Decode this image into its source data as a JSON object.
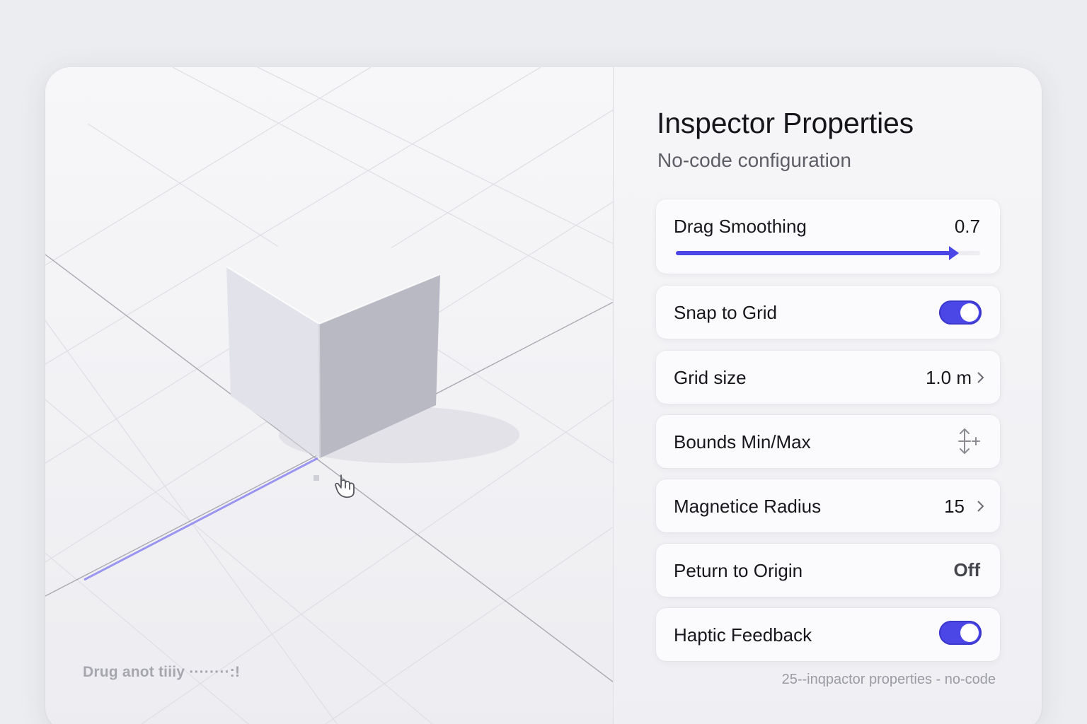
{
  "viewport": {
    "caption": "Drug anot tiiiy ········:!",
    "object": "cube",
    "cursor_icon": "hand-pointer-icon",
    "accent": "#8b86f0"
  },
  "inspector": {
    "title": "Inspector Properties",
    "subtitle": "No-code configuration",
    "accent": "#4b46e6",
    "drag_smoothing": {
      "label": "Drag Smoothing",
      "value": "0.7",
      "fraction": 0.93
    },
    "snap_to_grid": {
      "label": "Snap to Grid",
      "on": true
    },
    "grid_size": {
      "label": "Grid size",
      "value": "1.0 m"
    },
    "bounds": {
      "label": "Bounds Min/Max",
      "icon": "vertical-resize-plus-icon"
    },
    "magnetic_radius": {
      "label": "Magnetice Radius",
      "value": "15"
    },
    "return_to_origin": {
      "label": "Peturn to Origin",
      "value": "Off"
    },
    "haptic_feedback": {
      "label": "Haptic Feedback",
      "on": true
    },
    "footer": "25--inqpactor properties - no-code"
  }
}
